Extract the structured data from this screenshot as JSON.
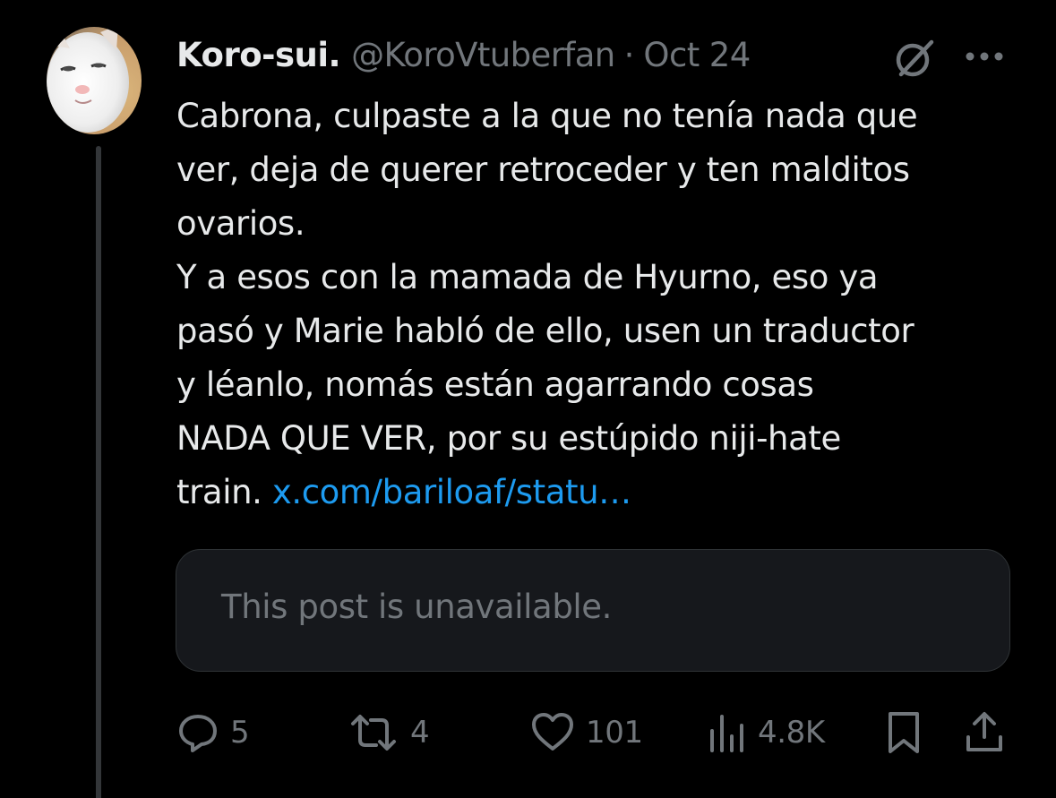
{
  "tweet": {
    "author_name": "Koro-sui.",
    "handle": "@KoroVtuberfan",
    "separator": "·",
    "date": "Oct 24",
    "text_lines": [
      "Cabrona, culpaste a la que no tenía nada que",
      "ver, deja de querer retroceder y ten malditos",
      "ovarios.",
      "Y a esos con la mamada de Hyurno, eso ya",
      "pasó y Marie habló de ello, usen un traductor",
      "y léanlo, nomás están agarrando cosas",
      "NADA QUE VER, por su estúpido niji-hate"
    ],
    "last_line_text": "train. ",
    "link_text": "x.com/bariloaf/statu…",
    "quote": {
      "unavailable_text": "This post is unavailable."
    },
    "actions": {
      "replies": "5",
      "reposts": "4",
      "likes": "101",
      "views": "4.8K"
    }
  },
  "icons": {
    "avatar": "avatar-cat-photo",
    "grok": "grok-icon",
    "more": "more-icon",
    "reply": "reply-icon",
    "repost": "repost-icon",
    "like": "like-icon",
    "views": "views-icon",
    "bookmark": "bookmark-icon",
    "share": "share-icon"
  },
  "colors": {
    "background": "#000000",
    "text": "#e7e9ea",
    "muted": "#71767b",
    "link": "#1d9bf0",
    "card_bg": "#16181c",
    "border": "#2f3336"
  }
}
